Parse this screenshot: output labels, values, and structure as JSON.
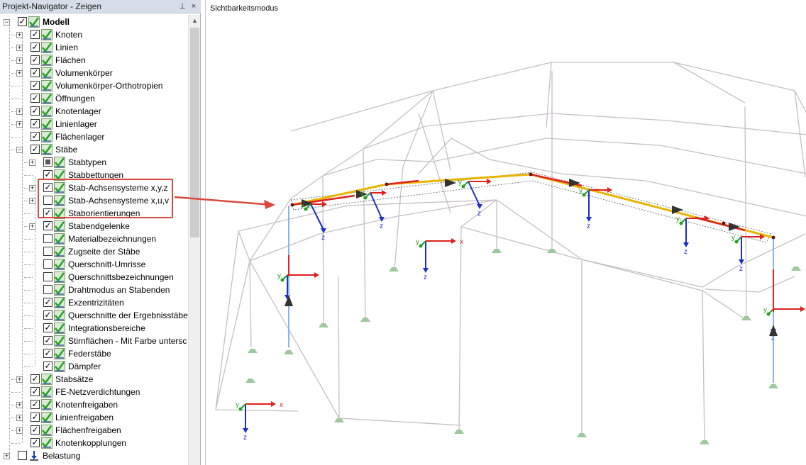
{
  "panel": {
    "title": "Projekt-Navigator - Zeigen",
    "pin_glyph": "⊥",
    "close_glyph": "×"
  },
  "tree": [
    {
      "label": "Modell",
      "level": 0,
      "expander": "minus",
      "check": "checked",
      "icon": "model-icon",
      "bold": true
    },
    {
      "label": "Knoten",
      "level": 1,
      "expander": "plus",
      "check": "checked",
      "icon": "visibility-icon"
    },
    {
      "label": "Linien",
      "level": 1,
      "expander": "plus",
      "check": "checked",
      "icon": "visibility-icon"
    },
    {
      "label": "Flächen",
      "level": 1,
      "expander": "plus",
      "check": "checked",
      "icon": "visibility-icon"
    },
    {
      "label": "Volumenkörper",
      "level": 1,
      "expander": "plus",
      "check": "checked",
      "icon": "visibility-icon"
    },
    {
      "label": "Volumenkörper-Orthotropien",
      "level": 1,
      "expander": "none",
      "check": "checked",
      "icon": "visibility-icon"
    },
    {
      "label": "Öffnungen",
      "level": 1,
      "expander": "none",
      "check": "checked",
      "icon": "visibility-icon"
    },
    {
      "label": "Knotenlager",
      "level": 1,
      "expander": "plus",
      "check": "checked",
      "icon": "visibility-icon"
    },
    {
      "label": "Linienlager",
      "level": 1,
      "expander": "plus",
      "check": "checked",
      "icon": "visibility-icon"
    },
    {
      "label": "Flächenlager",
      "level": 1,
      "expander": "none",
      "check": "checked",
      "icon": "visibility-icon"
    },
    {
      "label": "Stäbe",
      "level": 1,
      "expander": "minus",
      "check": "checked",
      "icon": "visibility-icon"
    },
    {
      "label": "Stabtypen",
      "level": 2,
      "expander": "plus",
      "check": "partial",
      "icon": "visibility-icon"
    },
    {
      "label": "Stabbettungen",
      "level": 2,
      "expander": "none",
      "check": "checked",
      "icon": "visibility-icon"
    },
    {
      "label": "Stab-Achsensysteme x,y,z",
      "level": 2,
      "expander": "plus",
      "check": "checked",
      "icon": "visibility-icon"
    },
    {
      "label": "Stab-Achsensysteme x,u,v",
      "level": 2,
      "expander": "plus",
      "check": "unchecked",
      "icon": "visibility-icon"
    },
    {
      "label": "Staborientierungen",
      "level": 2,
      "expander": "none",
      "check": "checked",
      "icon": "visibility-icon"
    },
    {
      "label": "Stabendgelenke",
      "level": 2,
      "expander": "plus",
      "check": "checked",
      "icon": "visibility-icon"
    },
    {
      "label": "Materialbezeichnungen",
      "level": 2,
      "expander": "none",
      "check": "unchecked",
      "icon": "visibility-icon"
    },
    {
      "label": "Zugseite der Stäbe",
      "level": 2,
      "expander": "none",
      "check": "unchecked",
      "icon": "visibility-icon"
    },
    {
      "label": "Querschnitt-Umrisse",
      "level": 2,
      "expander": "none",
      "check": "unchecked",
      "icon": "visibility-icon"
    },
    {
      "label": "Querschnittsbezeichnungen",
      "level": 2,
      "expander": "none",
      "check": "unchecked",
      "icon": "visibility-icon"
    },
    {
      "label": "Drahtmodus an Stabenden",
      "level": 2,
      "expander": "none",
      "check": "unchecked",
      "icon": "visibility-icon"
    },
    {
      "label": "Exzentrizitäten",
      "level": 2,
      "expander": "none",
      "check": "checked",
      "icon": "visibility-icon"
    },
    {
      "label": "Querschnitte der Ergebnisstäbe",
      "level": 2,
      "expander": "none",
      "check": "checked",
      "icon": "visibility-icon"
    },
    {
      "label": "Integrationsbereiche",
      "level": 2,
      "expander": "none",
      "check": "checked",
      "icon": "visibility-icon"
    },
    {
      "label": "Stirnflächen - Mit Farbe untersc",
      "level": 2,
      "expander": "none",
      "check": "checked",
      "icon": "visibility-icon"
    },
    {
      "label": "Federstäbe",
      "level": 2,
      "expander": "none",
      "check": "checked",
      "icon": "visibility-icon"
    },
    {
      "label": "Dämpfer",
      "level": 2,
      "expander": "none",
      "check": "checked",
      "icon": "visibility-icon"
    },
    {
      "label": "Stabsätze",
      "level": 1,
      "expander": "plus",
      "check": "checked",
      "icon": "visibility-icon"
    },
    {
      "label": "FE-Netzverdichtungen",
      "level": 1,
      "expander": "none",
      "check": "checked",
      "icon": "visibility-icon"
    },
    {
      "label": "Knotenfreigaben",
      "level": 1,
      "expander": "plus",
      "check": "checked",
      "icon": "visibility-icon"
    },
    {
      "label": "Linienfreigaben",
      "level": 1,
      "expander": "plus",
      "check": "checked",
      "icon": "visibility-icon"
    },
    {
      "label": "Flächenfreigaben",
      "level": 1,
      "expander": "plus",
      "check": "checked",
      "icon": "visibility-icon"
    },
    {
      "label": "Knotenkopplungen",
      "level": 1,
      "expander": "none",
      "check": "checked",
      "icon": "visibility-icon"
    },
    {
      "label": "Belastung",
      "level": 0,
      "expander": "plus",
      "check": "unchecked",
      "icon": "load-icon"
    }
  ],
  "viewport": {
    "title": "Sichtbarkeitsmodus",
    "axis_labels": {
      "x": "x",
      "y": "y",
      "z": "z"
    }
  },
  "colors": {
    "highlight": "#d9483b",
    "x_axis": "#e02020",
    "y_axis": "#22a122",
    "z_axis": "#1a2fd0",
    "frame": "#c4c0c4",
    "support": "#9ec89e",
    "member_highlight": "#e8b400"
  }
}
